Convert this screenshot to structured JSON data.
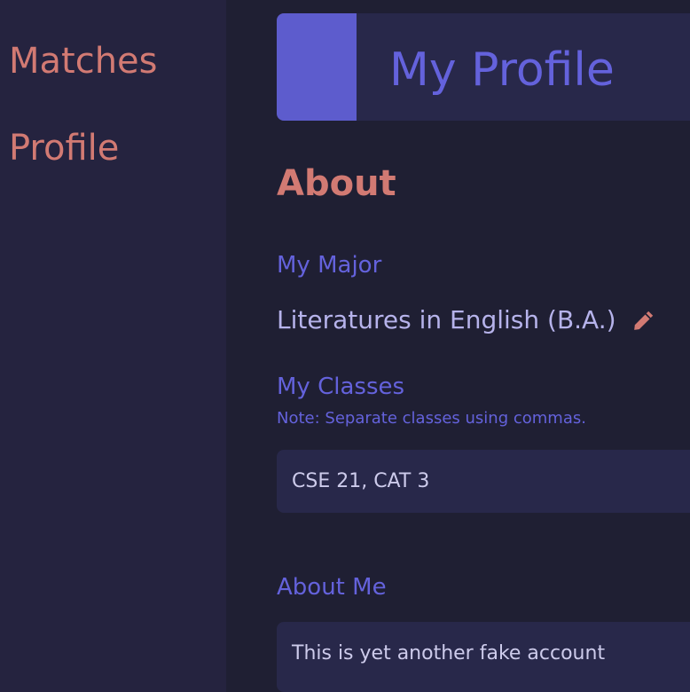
{
  "sidebar": {
    "items": [
      {
        "label": "Matches"
      },
      {
        "label": "Profile"
      }
    ]
  },
  "header": {
    "title": "My Profile"
  },
  "about": {
    "section_title": "About",
    "major": {
      "label": "My Major",
      "value": "Literatures in English (B.A.)"
    },
    "classes": {
      "label": "My Classes",
      "note": "Note: Separate classes using commas.",
      "value": "CSE 21, CAT 3"
    },
    "about_me": {
      "label": "About Me",
      "value": "This is yet another fake account"
    }
  },
  "icons": {
    "edit": "pencil-icon"
  },
  "colors": {
    "background": "#1f1f33",
    "sidebar": "#25233f",
    "card": "#28284a",
    "accent": "#5d5ccd",
    "heading_blue": "#6462dc",
    "salmon": "#d27a73",
    "light_text": "#b6b3eb"
  }
}
